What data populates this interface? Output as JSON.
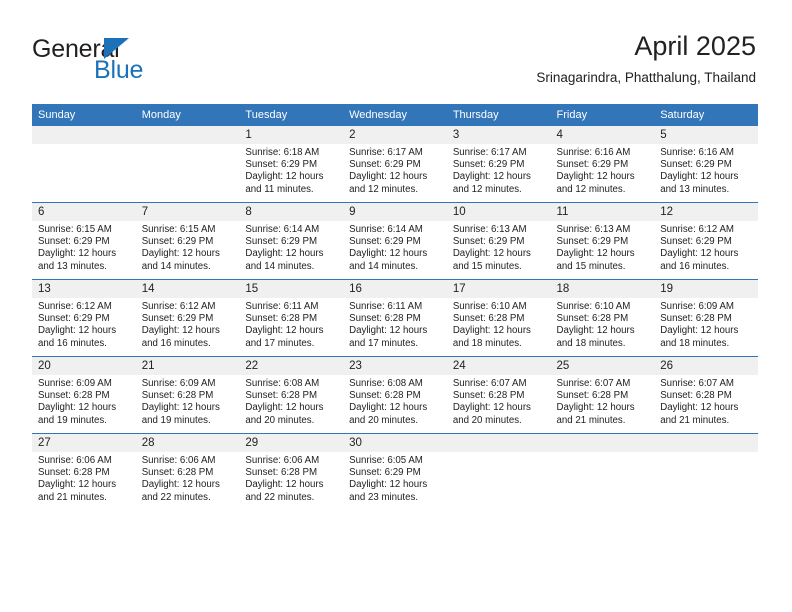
{
  "logo": {
    "word1": "General",
    "word2": "Blue",
    "triangle_color": "#1b72b8",
    "text_color": "#231f20"
  },
  "header": {
    "title": "April 2025",
    "subtitle": "Srinagarindra, Phatthalung, Thailand"
  },
  "theme": {
    "header_blue": "#3275b8",
    "day_band_gray": "#f0f0f0",
    "text": "#222222"
  },
  "weekday_headers": [
    "Sunday",
    "Monday",
    "Tuesday",
    "Wednesday",
    "Thursday",
    "Friday",
    "Saturday"
  ],
  "weeks": [
    [
      {
        "day": "",
        "sunrise": "",
        "sunset": "",
        "daylight1": "",
        "daylight2": ""
      },
      {
        "day": "",
        "sunrise": "",
        "sunset": "",
        "daylight1": "",
        "daylight2": ""
      },
      {
        "day": "1",
        "sunrise": "Sunrise: 6:18 AM",
        "sunset": "Sunset: 6:29 PM",
        "daylight1": "Daylight: 12 hours",
        "daylight2": "and 11 minutes."
      },
      {
        "day": "2",
        "sunrise": "Sunrise: 6:17 AM",
        "sunset": "Sunset: 6:29 PM",
        "daylight1": "Daylight: 12 hours",
        "daylight2": "and 12 minutes."
      },
      {
        "day": "3",
        "sunrise": "Sunrise: 6:17 AM",
        "sunset": "Sunset: 6:29 PM",
        "daylight1": "Daylight: 12 hours",
        "daylight2": "and 12 minutes."
      },
      {
        "day": "4",
        "sunrise": "Sunrise: 6:16 AM",
        "sunset": "Sunset: 6:29 PM",
        "daylight1": "Daylight: 12 hours",
        "daylight2": "and 12 minutes."
      },
      {
        "day": "5",
        "sunrise": "Sunrise: 6:16 AM",
        "sunset": "Sunset: 6:29 PM",
        "daylight1": "Daylight: 12 hours",
        "daylight2": "and 13 minutes."
      }
    ],
    [
      {
        "day": "6",
        "sunrise": "Sunrise: 6:15 AM",
        "sunset": "Sunset: 6:29 PM",
        "daylight1": "Daylight: 12 hours",
        "daylight2": "and 13 minutes."
      },
      {
        "day": "7",
        "sunrise": "Sunrise: 6:15 AM",
        "sunset": "Sunset: 6:29 PM",
        "daylight1": "Daylight: 12 hours",
        "daylight2": "and 14 minutes."
      },
      {
        "day": "8",
        "sunrise": "Sunrise: 6:14 AM",
        "sunset": "Sunset: 6:29 PM",
        "daylight1": "Daylight: 12 hours",
        "daylight2": "and 14 minutes."
      },
      {
        "day": "9",
        "sunrise": "Sunrise: 6:14 AM",
        "sunset": "Sunset: 6:29 PM",
        "daylight1": "Daylight: 12 hours",
        "daylight2": "and 14 minutes."
      },
      {
        "day": "10",
        "sunrise": "Sunrise: 6:13 AM",
        "sunset": "Sunset: 6:29 PM",
        "daylight1": "Daylight: 12 hours",
        "daylight2": "and 15 minutes."
      },
      {
        "day": "11",
        "sunrise": "Sunrise: 6:13 AM",
        "sunset": "Sunset: 6:29 PM",
        "daylight1": "Daylight: 12 hours",
        "daylight2": "and 15 minutes."
      },
      {
        "day": "12",
        "sunrise": "Sunrise: 6:12 AM",
        "sunset": "Sunset: 6:29 PM",
        "daylight1": "Daylight: 12 hours",
        "daylight2": "and 16 minutes."
      }
    ],
    [
      {
        "day": "13",
        "sunrise": "Sunrise: 6:12 AM",
        "sunset": "Sunset: 6:29 PM",
        "daylight1": "Daylight: 12 hours",
        "daylight2": "and 16 minutes."
      },
      {
        "day": "14",
        "sunrise": "Sunrise: 6:12 AM",
        "sunset": "Sunset: 6:29 PM",
        "daylight1": "Daylight: 12 hours",
        "daylight2": "and 16 minutes."
      },
      {
        "day": "15",
        "sunrise": "Sunrise: 6:11 AM",
        "sunset": "Sunset: 6:28 PM",
        "daylight1": "Daylight: 12 hours",
        "daylight2": "and 17 minutes."
      },
      {
        "day": "16",
        "sunrise": "Sunrise: 6:11 AM",
        "sunset": "Sunset: 6:28 PM",
        "daylight1": "Daylight: 12 hours",
        "daylight2": "and 17 minutes."
      },
      {
        "day": "17",
        "sunrise": "Sunrise: 6:10 AM",
        "sunset": "Sunset: 6:28 PM",
        "daylight1": "Daylight: 12 hours",
        "daylight2": "and 18 minutes."
      },
      {
        "day": "18",
        "sunrise": "Sunrise: 6:10 AM",
        "sunset": "Sunset: 6:28 PM",
        "daylight1": "Daylight: 12 hours",
        "daylight2": "and 18 minutes."
      },
      {
        "day": "19",
        "sunrise": "Sunrise: 6:09 AM",
        "sunset": "Sunset: 6:28 PM",
        "daylight1": "Daylight: 12 hours",
        "daylight2": "and 18 minutes."
      }
    ],
    [
      {
        "day": "20",
        "sunrise": "Sunrise: 6:09 AM",
        "sunset": "Sunset: 6:28 PM",
        "daylight1": "Daylight: 12 hours",
        "daylight2": "and 19 minutes."
      },
      {
        "day": "21",
        "sunrise": "Sunrise: 6:09 AM",
        "sunset": "Sunset: 6:28 PM",
        "daylight1": "Daylight: 12 hours",
        "daylight2": "and 19 minutes."
      },
      {
        "day": "22",
        "sunrise": "Sunrise: 6:08 AM",
        "sunset": "Sunset: 6:28 PM",
        "daylight1": "Daylight: 12 hours",
        "daylight2": "and 20 minutes."
      },
      {
        "day": "23",
        "sunrise": "Sunrise: 6:08 AM",
        "sunset": "Sunset: 6:28 PM",
        "daylight1": "Daylight: 12 hours",
        "daylight2": "and 20 minutes."
      },
      {
        "day": "24",
        "sunrise": "Sunrise: 6:07 AM",
        "sunset": "Sunset: 6:28 PM",
        "daylight1": "Daylight: 12 hours",
        "daylight2": "and 20 minutes."
      },
      {
        "day": "25",
        "sunrise": "Sunrise: 6:07 AM",
        "sunset": "Sunset: 6:28 PM",
        "daylight1": "Daylight: 12 hours",
        "daylight2": "and 21 minutes."
      },
      {
        "day": "26",
        "sunrise": "Sunrise: 6:07 AM",
        "sunset": "Sunset: 6:28 PM",
        "daylight1": "Daylight: 12 hours",
        "daylight2": "and 21 minutes."
      }
    ],
    [
      {
        "day": "27",
        "sunrise": "Sunrise: 6:06 AM",
        "sunset": "Sunset: 6:28 PM",
        "daylight1": "Daylight: 12 hours",
        "daylight2": "and 21 minutes."
      },
      {
        "day": "28",
        "sunrise": "Sunrise: 6:06 AM",
        "sunset": "Sunset: 6:28 PM",
        "daylight1": "Daylight: 12 hours",
        "daylight2": "and 22 minutes."
      },
      {
        "day": "29",
        "sunrise": "Sunrise: 6:06 AM",
        "sunset": "Sunset: 6:28 PM",
        "daylight1": "Daylight: 12 hours",
        "daylight2": "and 22 minutes."
      },
      {
        "day": "30",
        "sunrise": "Sunrise: 6:05 AM",
        "sunset": "Sunset: 6:29 PM",
        "daylight1": "Daylight: 12 hours",
        "daylight2": "and 23 minutes."
      },
      {
        "day": "",
        "sunrise": "",
        "sunset": "",
        "daylight1": "",
        "daylight2": ""
      },
      {
        "day": "",
        "sunrise": "",
        "sunset": "",
        "daylight1": "",
        "daylight2": ""
      },
      {
        "day": "",
        "sunrise": "",
        "sunset": "",
        "daylight1": "",
        "daylight2": ""
      }
    ]
  ]
}
